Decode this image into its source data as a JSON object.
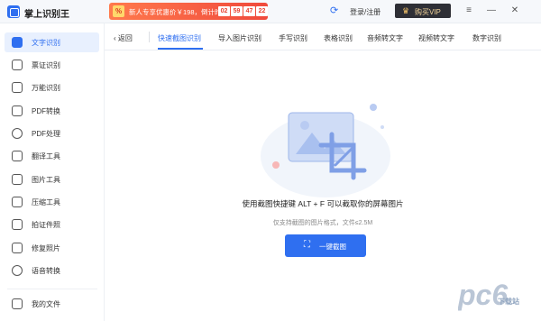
{
  "app": {
    "title": "掌上识别王"
  },
  "promo": {
    "icon_text": "%",
    "text": "新人专享优惠价￥198，倒计时",
    "countdown": [
      "02",
      "59",
      "47",
      "22"
    ]
  },
  "header": {
    "login_label": "登录/注册",
    "vip_label": "购买VIP"
  },
  "sidebar": {
    "items": [
      {
        "label": "文字识别",
        "icon": "text-recognition-icon",
        "active": true
      },
      {
        "label": "票证识别",
        "icon": "ticket-icon"
      },
      {
        "label": "万能识别",
        "icon": "universal-scan-icon"
      },
      {
        "label": "PDF转换",
        "icon": "pdf-convert-icon"
      },
      {
        "label": "PDF处理",
        "icon": "pdf-process-icon"
      },
      {
        "label": "翻译工具",
        "icon": "translate-icon"
      },
      {
        "label": "图片工具",
        "icon": "image-tool-icon"
      },
      {
        "label": "压缩工具",
        "icon": "compress-icon"
      },
      {
        "label": "拍证件照",
        "icon": "id-photo-icon"
      },
      {
        "label": "修复照片",
        "icon": "photo-repair-icon"
      },
      {
        "label": "语音转换",
        "icon": "voice-convert-icon"
      }
    ],
    "my_files": "我的文件"
  },
  "tabs": {
    "back_label": "返回",
    "items": [
      "快速截图识别",
      "导入图片识别",
      "手写识别",
      "表格识别",
      "音频转文字",
      "视频转文字",
      "数字识别"
    ],
    "active_index": 0
  },
  "main": {
    "instruction": "使用截图快捷键 ALT + F 可以截取你的屏幕图片",
    "note": "仅支持截图的图片格式，文件≤2.5M",
    "button_label": "一键截图"
  },
  "watermark": {
    "text": "pc6",
    "subtext": "下载站"
  },
  "colors": {
    "accent": "#2f6ff0",
    "promo": "#f04a3c",
    "vip_bg": "#2e2f36",
    "vip_text": "#f3d49b"
  }
}
